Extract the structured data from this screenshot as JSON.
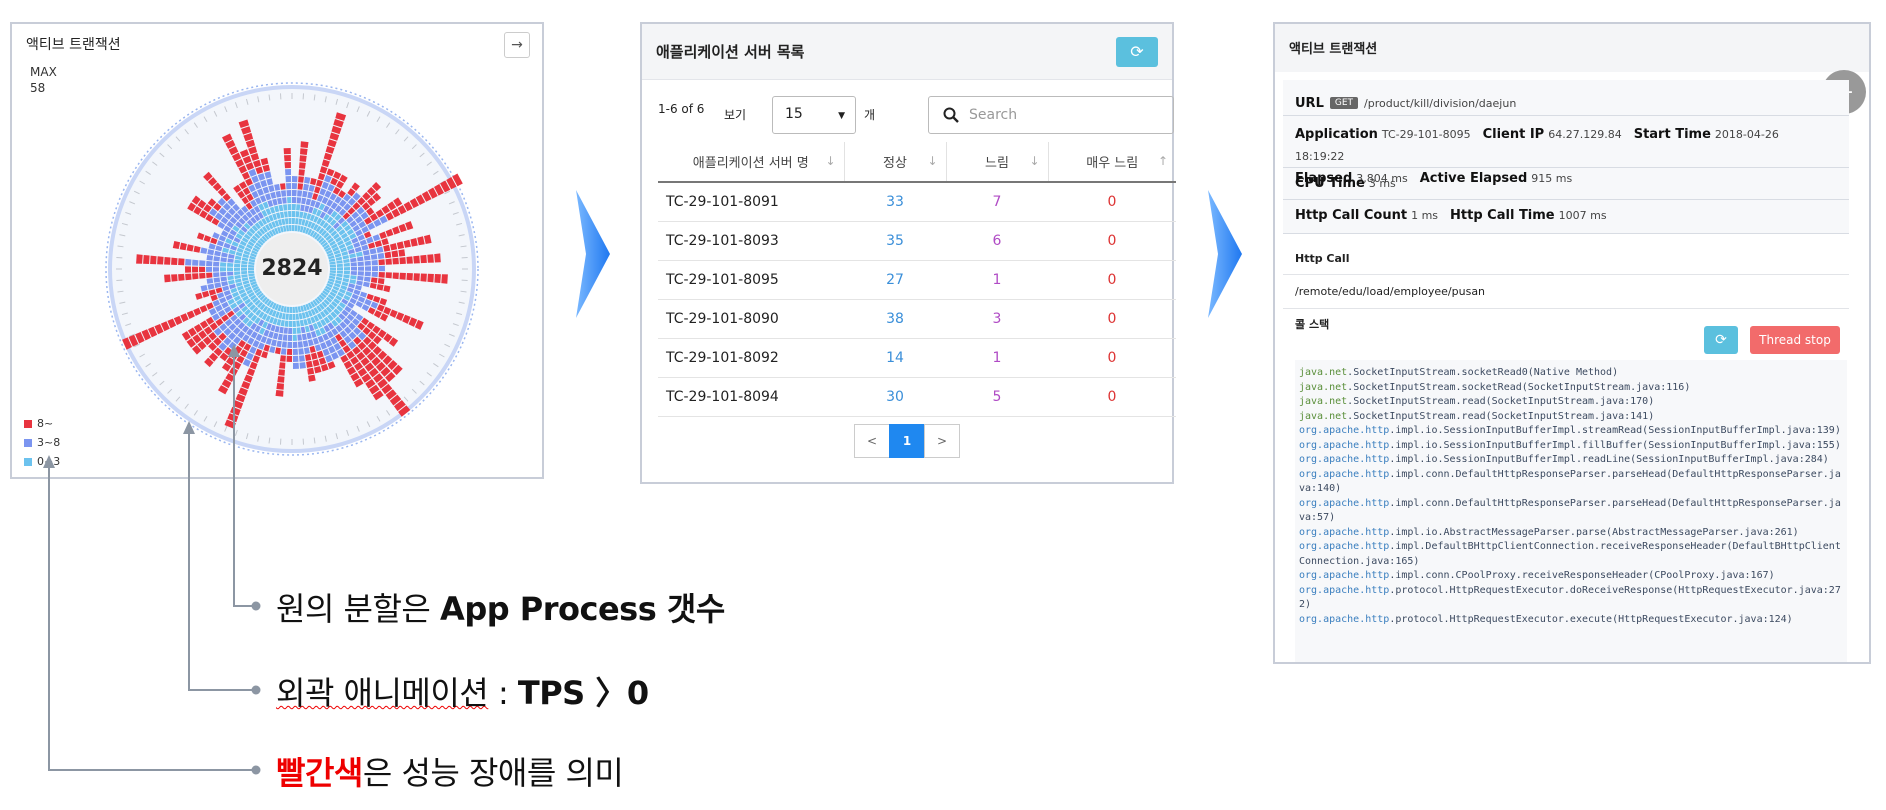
{
  "panel1": {
    "title": "액티브 트랜잭션",
    "max_label": "MAX",
    "max_value": "58",
    "center_value": "2824",
    "legend": [
      {
        "label": "8~",
        "color": "#e8343f"
      },
      {
        "label": "3~8",
        "color": "#7b95f0"
      },
      {
        "label": "0~3",
        "color": "#6cc2ee"
      }
    ]
  },
  "panel2": {
    "title": "애플리케이션 서버 목록",
    "range_text": "1-6 of 6",
    "show_label": "보기",
    "page_size": "15",
    "unit_label": "개",
    "search_placeholder": "Search",
    "columns": [
      "애플리케이션 서버 명",
      "정상",
      "느림",
      "매우 느림"
    ],
    "sort_icons": [
      "↓",
      "↓",
      "↓",
      "↑"
    ],
    "rows": [
      {
        "name": "TC-29-101-8091",
        "normal": "33",
        "slow": "7",
        "very_slow": "0"
      },
      {
        "name": "TC-29-101-8093",
        "normal": "35",
        "slow": "6",
        "very_slow": "0"
      },
      {
        "name": "TC-29-101-8095",
        "normal": "27",
        "slow": "1",
        "very_slow": "0"
      },
      {
        "name": "TC-29-101-8090",
        "normal": "38",
        "slow": "3",
        "very_slow": "0"
      },
      {
        "name": "TC-29-101-8092",
        "normal": "14",
        "slow": "1",
        "very_slow": "0"
      },
      {
        "name": "TC-29-101-8094",
        "normal": "30",
        "slow": "5",
        "very_slow": "0"
      }
    ],
    "pager": {
      "prev": "<",
      "current": "1",
      "next": ">"
    }
  },
  "panel3": {
    "title": "액티브 트랜잭션",
    "url_label": "URL",
    "method": "GET",
    "url": "/product/kill/division/daejun",
    "application_label": "Application",
    "application": "TC-29-101-8095",
    "client_ip_label": "Client IP",
    "client_ip": "64.27.129.84",
    "start_time_label": "Start Time",
    "start_time": "2018-04-26 18:19:22",
    "elapsed_label": "Elapsed",
    "elapsed": "3,804 ms",
    "active_elapsed_label": "Active Elapsed",
    "active_elapsed": "915 ms",
    "cpu_time_label": "CPU Time",
    "cpu_time": "3 ms",
    "http_call_count_label": "Http Call Count",
    "http_call_count": "1 ms",
    "http_call_time_label": "Http Call Time",
    "http_call_time": "1007 ms",
    "http_call_label": "Http Call",
    "http_call_path": "/remote/edu/load/employee/pusan",
    "call_stack_label": "콜 스택",
    "thread_stop_label": "Thread stop",
    "stack": [
      {
        "pkg": "java.net",
        "rest": ".SocketInputStream.socketRead0(Native Method)"
      },
      {
        "pkg": "java.net",
        "rest": ".SocketInputStream.socketRead(SocketInputStream.java:116)"
      },
      {
        "pkg": "java.net",
        "rest": ".SocketInputStream.read(SocketInputStream.java:170)"
      },
      {
        "pkg": "java.net",
        "rest": ".SocketInputStream.read(SocketInputStream.java:141)"
      },
      {
        "pkg": "org.apache.http",
        "rest": ".impl.io.SessionInputBufferImpl.streamRead(SessionInputBufferImpl.java:139)"
      },
      {
        "pkg": "org.apache.http",
        "rest": ".impl.io.SessionInputBufferImpl.fillBuffer(SessionInputBufferImpl.java:155)"
      },
      {
        "pkg": "org.apache.http",
        "rest": ".impl.io.SessionInputBufferImpl.readLine(SessionInputBufferImpl.java:284)"
      },
      {
        "pkg": "org.apache.http",
        "rest": ".impl.conn.DefaultHttpResponseParser.parseHead(DefaultHttpResponseParser.java:140)"
      },
      {
        "pkg": "org.apache.http",
        "rest": ".impl.conn.DefaultHttpResponseParser.parseHead(DefaultHttpResponseParser.java:57)"
      },
      {
        "pkg": "org.apache.http",
        "rest": ".impl.io.AbstractMessageParser.parse(AbstractMessageParser.java:261)"
      },
      {
        "pkg": "org.apache.http",
        "rest": ".impl.DefaultBHttpClientConnection.receiveResponseHeader(DefaultBHttpClientConnection.java:165)"
      },
      {
        "pkg": "org.apache.http",
        "rest": ".impl.conn.CPoolProxy.receiveResponseHeader(CPoolProxy.java:167)"
      },
      {
        "pkg": "org.apache.http",
        "rest": ".protocol.HttpRequestExecutor.doReceiveResponse(HttpRequestExecutor.java:272)"
      },
      {
        "pkg": "org.apache.http",
        "rest": ".protocol.HttpRequestExecutor.execute(HttpRequestExecutor.java:124)"
      }
    ]
  },
  "annotations": {
    "a1_pre": "원의 분할은 ",
    "a1_bold": "App Process 갯수",
    "a2_wavy": "외곽 애니메이션",
    "a2_mid": " : ",
    "a2_bold": "TPS 〉0",
    "a3_red": "빨간색",
    "a3_rest": "은 성능 장애를 의미"
  },
  "colors": {
    "red": "#e8343f",
    "purple": "#7b95f0",
    "blue": "#6cc2ee",
    "accent": "#1f88f0",
    "arrow": "#1f88f0"
  },
  "icons": [
    "arrow-right-icon",
    "refresh-icon",
    "search-icon",
    "caret-down-icon",
    "arrow-left-icon"
  ]
}
